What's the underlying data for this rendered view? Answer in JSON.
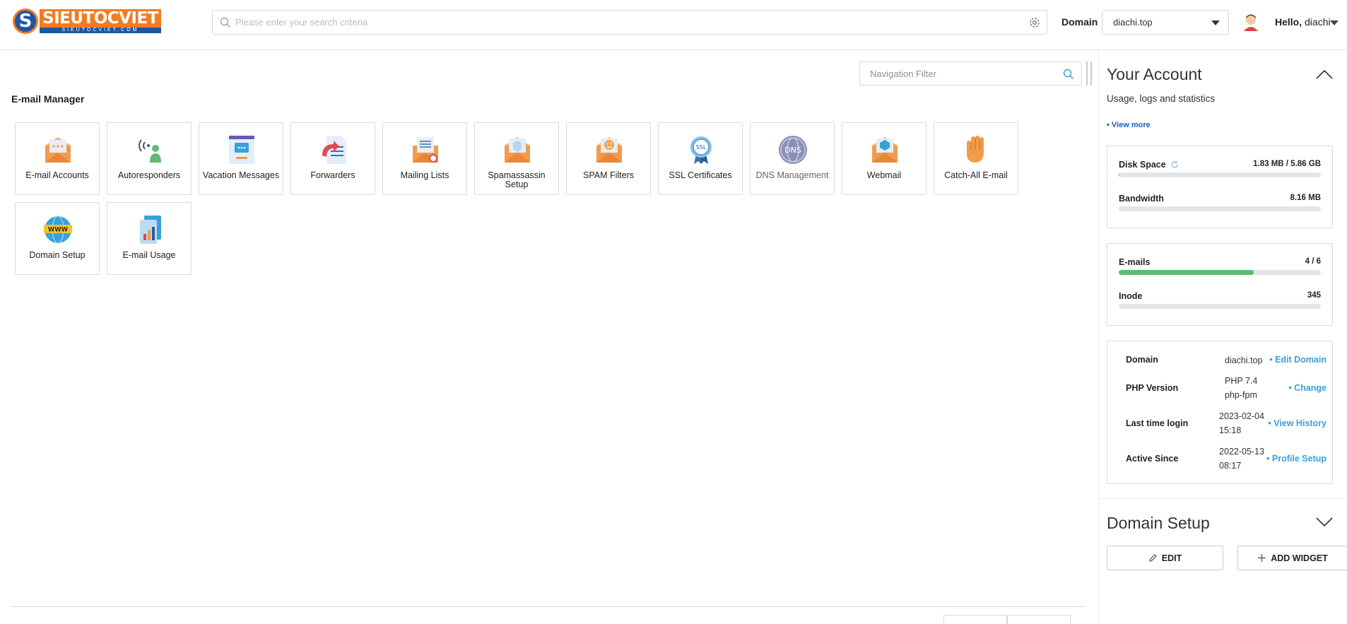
{
  "header": {
    "logo_text": "SIEUTOCVIET",
    "logo_sub": "SIEUTOCVIET.COM",
    "logo_letter": "S",
    "search_placeholder": "Please enter your search criteria",
    "domain_label": "Domain",
    "domain_value": "diachi.top",
    "hello_prefix": "Hello,",
    "username": "diachi"
  },
  "main": {
    "nav_filter_placeholder": "Navigation Filter",
    "section_title": "E-mail Manager",
    "tiles": [
      {
        "label": "E-mail Accounts",
        "icon": "email-accounts-icon"
      },
      {
        "label": "Autoresponders",
        "icon": "autoresponders-icon"
      },
      {
        "label": "Vacation Messages",
        "icon": "vacation-messages-icon"
      },
      {
        "label": "Forwarders",
        "icon": "forwarders-icon"
      },
      {
        "label": "Mailing Lists",
        "icon": "mailing-lists-icon"
      },
      {
        "label": "Spamassassin Setup",
        "icon": "spamassassin-icon"
      },
      {
        "label": "SPAM Filters",
        "icon": "spam-filters-icon"
      },
      {
        "label": "SSL Certificates",
        "icon": "ssl-certificates-icon"
      },
      {
        "label": "DNS Management",
        "icon": "dns-management-icon"
      },
      {
        "label": "Webmail",
        "icon": "webmail-icon"
      },
      {
        "label": "Catch-All E-mail",
        "icon": "catch-all-icon"
      },
      {
        "label": "Domain Setup",
        "icon": "domain-setup-icon"
      },
      {
        "label": "E-mail Usage",
        "icon": "email-usage-icon"
      }
    ]
  },
  "account": {
    "title": "Your Account",
    "subtitle": "Usage, logs and statistics",
    "view_more": "• View more",
    "stats": [
      {
        "name": "Disk Space",
        "value": "1.83 MB / 5.86 GB",
        "fraction": 0.0003
      },
      {
        "name": "Bandwidth",
        "value": "8.16 MB",
        "fraction": 0
      },
      {
        "name": "E-mails",
        "value": "4 / 6",
        "fraction": 0.667
      },
      {
        "name": "Inode",
        "value": "345",
        "fraction": 0
      }
    ],
    "info": [
      {
        "key": "Domain",
        "value": "diachi.top",
        "action": "• Edit Domain"
      },
      {
        "key": "PHP Version",
        "value": "PHP 7.4 php-fpm",
        "action": "• Change"
      },
      {
        "key": "Last time login",
        "value": "2023-02-04 15:18",
        "action": "• View History"
      },
      {
        "key": "Active Since",
        "value": "2022-05-13 08:17",
        "action": "• Profile Setup"
      }
    ]
  },
  "domain_setup": {
    "title": "Domain Setup",
    "edit_label": "EDIT",
    "add_widget_label": "ADD WIDGET"
  },
  "colors": {
    "brand_orange": "#f47b20",
    "brand_blue": "#1e56a6",
    "progress_green": "#5dbb74",
    "link_blue": "#3aa0d8"
  }
}
